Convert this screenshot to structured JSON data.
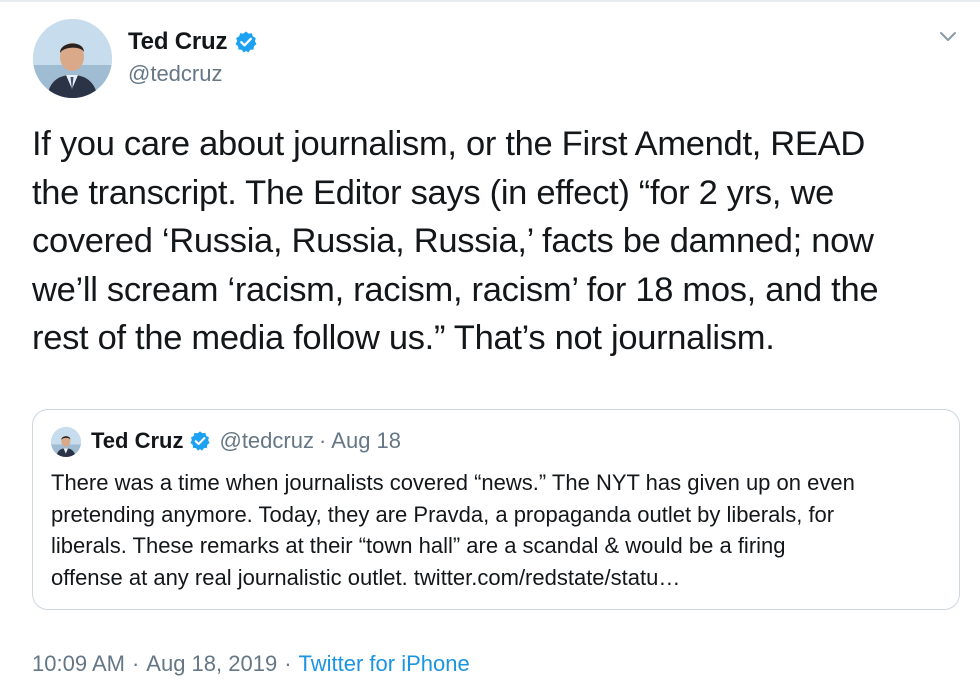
{
  "author": {
    "display_name": "Ted Cruz",
    "handle": "@tedcruz",
    "verified": true,
    "verified_color": "#1da1f2"
  },
  "tweet": {
    "text": "If you care about journalism, or the First Amendt, READ\nthe transcript. The Editor says (in effect) “for 2 yrs, we\ncovered ‘Russia, Russia, Russia,’ facts be damned; now\nwe’ll scream ‘racism, racism, racism’ for 18 mos, and the\nrest of the media follow us.” That’s not journalism.",
    "time": "10:09 AM",
    "date": "Aug 18, 2019",
    "separator": "·",
    "source": "Twitter for iPhone"
  },
  "quoted_tweet": {
    "display_name": "Ted Cruz",
    "handle": "@tedcruz",
    "separator": "·",
    "date": "Aug 18",
    "text": "There was a time when journalists covered “news.” The NYT has given up on even\npretending anymore. Today, they are Pravda, a propaganda outlet by liberals, for\nliberals. These remarks at their “town hall” are a scandal & would be a firing\noffense at any real journalistic outlet. twitter.com/redstate/statu…"
  },
  "icons": {
    "menu": "chevron-down-icon",
    "verified": "verified-badge-icon"
  },
  "colors": {
    "text": "#14171a",
    "secondary": "#657786",
    "link": "#1b95e0",
    "border": "#ccd6dd"
  }
}
